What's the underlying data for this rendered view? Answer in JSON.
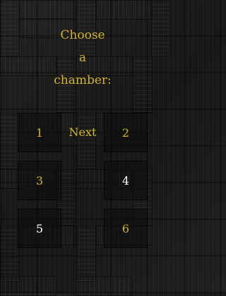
{
  "title": {
    "line1": "Choose",
    "line2": "a",
    "line3": "chamber:"
  },
  "next_label": "Next",
  "chambers": [
    {
      "label": "1",
      "color": "#d4b42e"
    },
    {
      "label": "2",
      "color": "#d4b42e"
    },
    {
      "label": "3",
      "color": "#d4b42e"
    },
    {
      "label": "4",
      "color": "#ffffff"
    },
    {
      "label": "5",
      "color": "#ffffff"
    },
    {
      "label": "6",
      "color": "#d4b42e"
    }
  ],
  "colors": {
    "accent_gold": "#d4b42e",
    "background": "#1b1b1b"
  }
}
